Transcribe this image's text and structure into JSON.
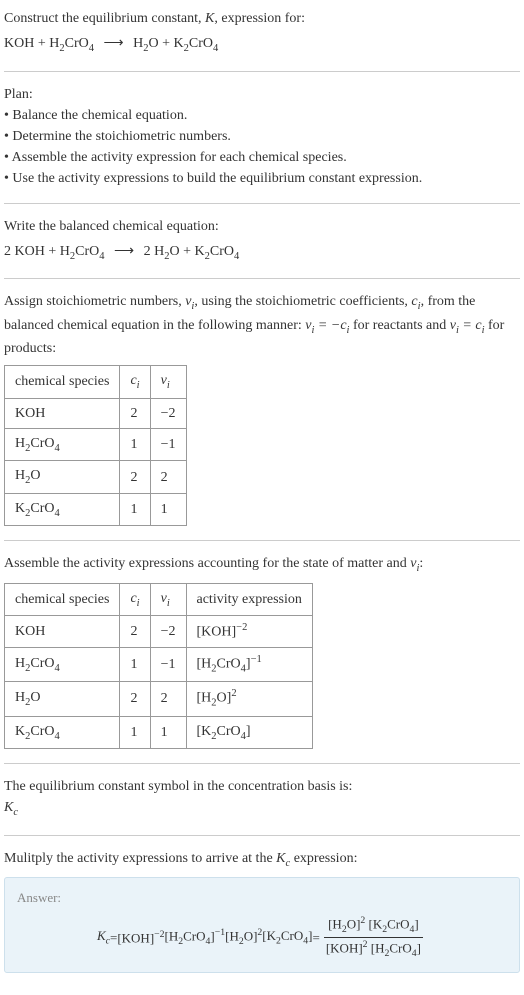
{
  "intro": {
    "line1": "Construct the equilibrium constant, ",
    "K": "K",
    "line1b": ", expression for:"
  },
  "eq1": {
    "lhs1": "KOH",
    "plus": " + ",
    "lhs2_h": "H",
    "lhs2_2": "2",
    "lhs2_cro": "CrO",
    "lhs2_4": "4",
    "arrow": "⟶",
    "rhs1_h": "H",
    "rhs1_2": "2",
    "rhs1_o": "O",
    "rhs2_k": "K",
    "rhs2_2": "2",
    "rhs2_cro": "CrO",
    "rhs2_4": "4"
  },
  "plan": {
    "title": "Plan:",
    "i1": "• Balance the chemical equation.",
    "i2": "• Determine the stoichiometric numbers.",
    "i3": "• Assemble the activity expression for each chemical species.",
    "i4": "• Use the activity expressions to build the equilibrium constant expression."
  },
  "balanced": {
    "title": "Write the balanced chemical equation:",
    "c1": "2 KOH",
    "c2a": "H",
    "c2b": "2",
    "c2c": "CrO",
    "c2d": "4",
    "arrow": "⟶",
    "c3": "2 H",
    "c3b": "2",
    "c3c": "O",
    "c4a": "K",
    "c4b": "2",
    "c4c": "CrO",
    "c4d": "4"
  },
  "assign": {
    "p1": "Assign stoichiometric numbers, ",
    "nu": "ν",
    "nui": "i",
    "p2": ", using the stoichiometric coefficients, ",
    "c": "c",
    "ci": "i",
    "p3": ", from the balanced chemical equation in the following manner: ",
    "eq1a": "ν",
    "eq1b": "i",
    "eq1c": " = −",
    "eq1d": "c",
    "eq1e": "i",
    "p4": " for reactants and ",
    "eq2a": "ν",
    "eq2b": "i",
    "eq2c": " = ",
    "eq2d": "c",
    "eq2e": "i",
    "p5": " for products:"
  },
  "table1": {
    "h1": "chemical species",
    "h2a": "c",
    "h2b": "i",
    "h3a": "ν",
    "h3b": "i",
    "r1": {
      "s": "KOH",
      "c": "2",
      "n": "−2"
    },
    "r2": {
      "sa": "H",
      "sb": "2",
      "sc": "CrO",
      "sd": "4",
      "c": "1",
      "n": "−1"
    },
    "r3": {
      "sa": "H",
      "sb": "2",
      "sc": "O",
      "c": "2",
      "n": "2"
    },
    "r4": {
      "sa": "K",
      "sb": "2",
      "sc": "CrO",
      "sd": "4",
      "c": "1",
      "n": "1"
    }
  },
  "assemble": {
    "p1": "Assemble the activity expressions accounting for the state of matter and ",
    "nu": "ν",
    "nui": "i",
    "p2": ":"
  },
  "table2": {
    "h1": "chemical species",
    "h2a": "c",
    "h2b": "i",
    "h3a": "ν",
    "h3b": "i",
    "h4": "activity expression",
    "r1": {
      "s": "KOH",
      "c": "2",
      "n": "−2",
      "ea": "[KOH]",
      "eb": "−2"
    },
    "r2": {
      "sa": "H",
      "sb": "2",
      "sc": "CrO",
      "sd": "4",
      "c": "1",
      "n": "−1",
      "ea1": "[H",
      "ea2": "2",
      "ea3": "CrO",
      "ea4": "4",
      "ea5": "]",
      "eb": "−1"
    },
    "r3": {
      "sa": "H",
      "sb": "2",
      "sc": "O",
      "c": "2",
      "n": "2",
      "ea1": "[H",
      "ea2": "2",
      "ea3": "O]",
      "eb": "2"
    },
    "r4": {
      "sa": "K",
      "sb": "2",
      "sc": "CrO",
      "sd": "4",
      "c": "1",
      "n": "1",
      "ea1": "[K",
      "ea2": "2",
      "ea3": "CrO",
      "ea4": "4",
      "ea5": "]"
    }
  },
  "symbol": {
    "p1": "The equilibrium constant symbol in the concentration basis is:",
    "kc_k": "K",
    "kc_c": "c"
  },
  "multiply": {
    "p1": "Mulitply the activity expressions to arrive at the ",
    "kc_k": "K",
    "kc_c": "c",
    "p2": " expression:"
  },
  "answer": {
    "label": "Answer:",
    "kc_k": "K",
    "kc_c": "c",
    "eq": " = ",
    "t1": "[KOH]",
    "t1e": "−2",
    "sp": " ",
    "t2a": "[H",
    "t2b": "2",
    "t2c": "CrO",
    "t2d": "4",
    "t2e": "]",
    "t2exp": "−1",
    "t3a": "[H",
    "t3b": "2",
    "t3c": "O]",
    "t3exp": "2",
    "t4a": "[K",
    "t4b": "2",
    "t4c": "CrO",
    "t4d": "4",
    "t4e": "]",
    "eq2": " = ",
    "num1a": "[H",
    "num1b": "2",
    "num1c": "O]",
    "num1e": "2",
    "num2a": "[K",
    "num2b": "2",
    "num2c": "CrO",
    "num2d": "4",
    "num2e": "]",
    "den1": "[KOH]",
    "den1e": "2",
    "den2a": "[H",
    "den2b": "2",
    "den2c": "CrO",
    "den2d": "4",
    "den2e": "]"
  }
}
